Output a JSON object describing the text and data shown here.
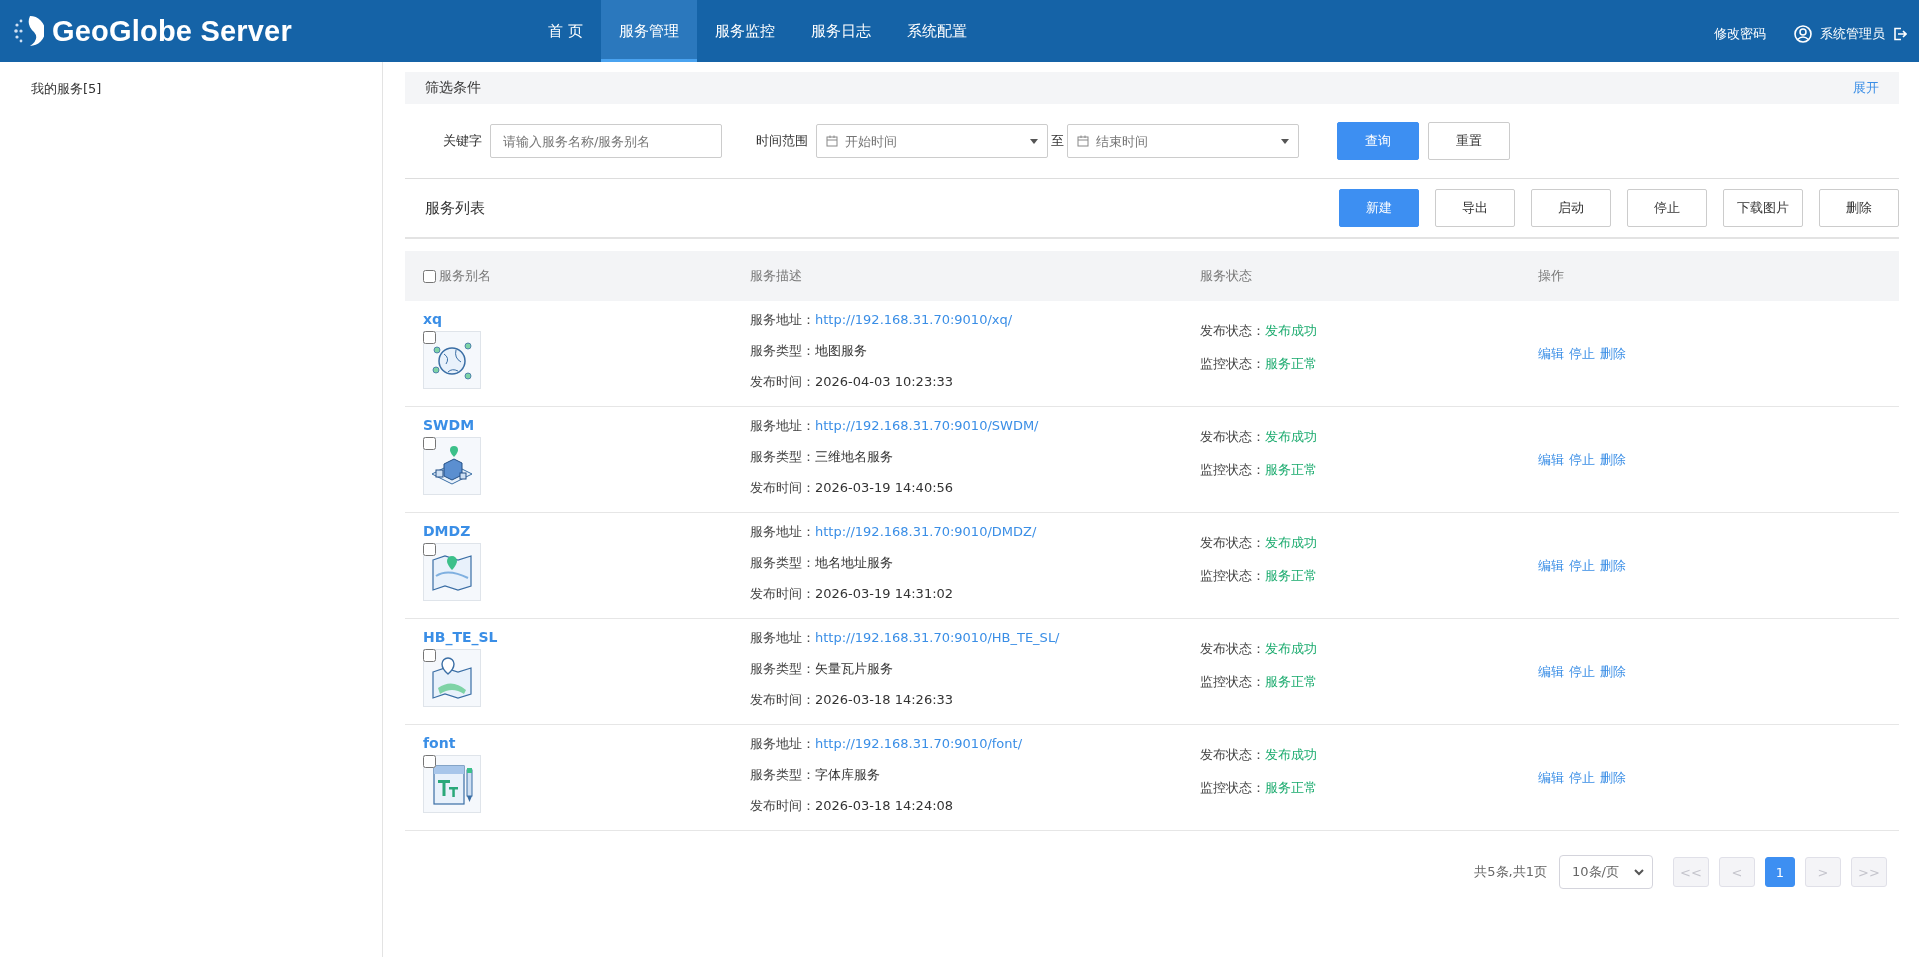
{
  "header": {
    "logo": "GeoGlobe Server",
    "nav": [
      {
        "label": "首 页",
        "selected": false
      },
      {
        "label": "服务管理",
        "selected": true
      },
      {
        "label": "服务监控",
        "selected": false
      },
      {
        "label": "服务日志",
        "selected": false
      },
      {
        "label": "系统配置",
        "selected": false
      }
    ],
    "change_password": "修改密码",
    "user": "系统管理员"
  },
  "sidebar": {
    "items": [
      {
        "label": "我的服务[5]"
      }
    ]
  },
  "filter": {
    "title": "筛选条件",
    "expand": "展开",
    "keyword_label": "关键字",
    "keyword_placeholder": "请输入服务名称/服务别名",
    "time_label": "时间范围",
    "start_placeholder": "开始时间",
    "to": "至",
    "end_placeholder": "结束时间",
    "query": "查询",
    "reset": "重置"
  },
  "list": {
    "title": "服务列表",
    "buttons": [
      {
        "label": "新建",
        "kind": "primary"
      },
      {
        "label": "导出",
        "kind": "plain"
      },
      {
        "label": "启动",
        "kind": "plain"
      },
      {
        "label": "停止",
        "kind": "plain"
      },
      {
        "label": "下载图片",
        "kind": "plain"
      },
      {
        "label": "删除",
        "kind": "plain"
      }
    ]
  },
  "table": {
    "columns": [
      {
        "label": "服务别名",
        "checked": false
      },
      {
        "label": "服务描述"
      },
      {
        "label": "服务状态"
      },
      {
        "label": "操作"
      }
    ],
    "rows": [
      {
        "name": "xq",
        "kind": "globe",
        "checked": false,
        "address_label": "服务地址：",
        "address": "http://192.168.31.70:9010/xq/",
        "type_label": "服务类型：",
        "type": "地图服务",
        "time_label": "发布时间：",
        "time": "2026-04-03 10:23:33",
        "publish_label": "发布状态：",
        "publish": "发布成功",
        "monitor_label": "监控状态：",
        "monitor": "服务正常",
        "actions": [
          "编辑",
          "停止",
          "删除"
        ]
      },
      {
        "name": "SWDM",
        "kind": "building",
        "checked": false,
        "address_label": "服务地址：",
        "address": "http://192.168.31.70:9010/SWDM/",
        "type_label": "服务类型：",
        "type": "三维地名服务",
        "time_label": "发布时间：",
        "time": "2026-03-19 14:40:56",
        "publish_label": "发布状态：",
        "publish": "发布成功",
        "monitor_label": "监控状态：",
        "monitor": "服务正常",
        "actions": [
          "编辑",
          "停止",
          "删除"
        ]
      },
      {
        "name": "DMDZ",
        "kind": "map",
        "checked": false,
        "address_label": "服务地址：",
        "address": "http://192.168.31.70:9010/DMDZ/",
        "type_label": "服务类型：",
        "type": "地名地址服务",
        "time_label": "发布时间：",
        "time": "2026-03-19 14:31:02",
        "publish_label": "发布状态：",
        "publish": "发布成功",
        "monitor_label": "监控状态：",
        "monitor": "服务正常",
        "actions": [
          "编辑",
          "停止",
          "删除"
        ]
      },
      {
        "name": "HB_TE_SL",
        "kind": "pinmap",
        "checked": false,
        "address_label": "服务地址：",
        "address": "http://192.168.31.70:9010/HB_TE_SL/",
        "type_label": "服务类型：",
        "type": "矢量瓦片服务",
        "time_label": "发布时间：",
        "time": "2026-03-18 14:26:33",
        "publish_label": "发布状态：",
        "publish": "发布成功",
        "monitor_label": "监控状态：",
        "monitor": "服务正常",
        "actions": [
          "编辑",
          "停止",
          "删除"
        ]
      },
      {
        "name": "font",
        "kind": "font",
        "checked": false,
        "address_label": "服务地址：",
        "address": "http://192.168.31.70:9010/font/",
        "type_label": "服务类型：",
        "type": "字体库服务",
        "time_label": "发布时间：",
        "time": "2026-03-18 14:24:08",
        "publish_label": "发布状态：",
        "publish": "发布成功",
        "monitor_label": "监控状态：",
        "monitor": "服务正常",
        "actions": [
          "编辑",
          "停止",
          "删除"
        ]
      }
    ]
  },
  "pagination": {
    "summary": "共5条,共1页",
    "page_size": "10条/页",
    "pages": [
      {
        "label": "<<",
        "selected": false,
        "disabled": true
      },
      {
        "label": "<",
        "selected": false,
        "disabled": true
      },
      {
        "label": "1",
        "selected": true,
        "disabled": false
      },
      {
        "label": ">",
        "selected": false,
        "disabled": true
      },
      {
        "label": ">>",
        "selected": false,
        "disabled": true
      }
    ]
  }
}
